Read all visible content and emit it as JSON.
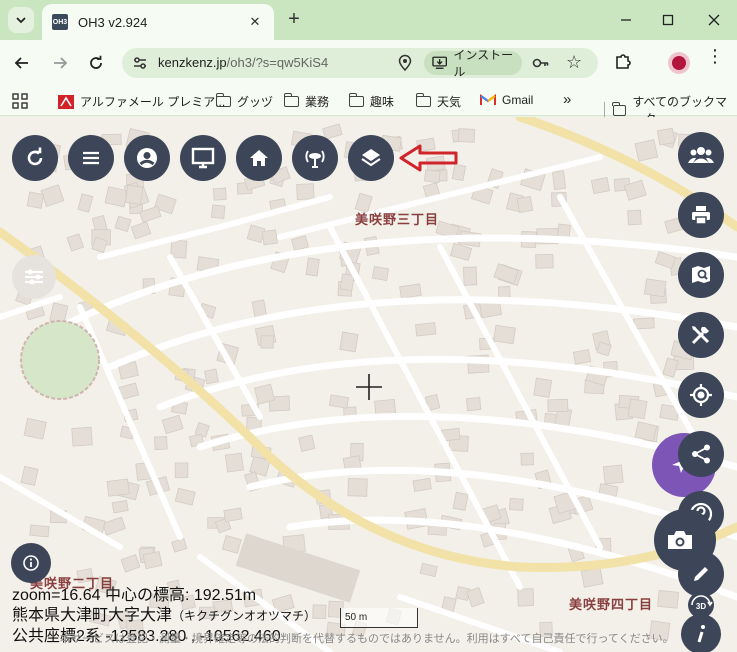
{
  "browser": {
    "tab_title": "OH3 v2.924",
    "tab_favicon": "OH3",
    "url_host": "kenzkenz.jp",
    "url_path": "/oh3/?s=qw5KiS4",
    "install_label": "インストール"
  },
  "bookmarks": [
    {
      "label": "アルファメール プレミア...",
      "icon": "alpha-mail-icon"
    },
    {
      "label": "グッヅ",
      "icon": "folder-icon"
    },
    {
      "label": "業務",
      "icon": "folder-icon"
    },
    {
      "label": "趣味",
      "icon": "folder-icon"
    },
    {
      "label": "天気",
      "icon": "folder-icon"
    },
    {
      "label": "Gmail",
      "icon": "gmail-icon"
    },
    {
      "label": "»",
      "icon": "more-icon"
    },
    {
      "label": "すべてのブックマーク",
      "icon": "folder-icon"
    }
  ],
  "map": {
    "town_labels": [
      "美咲野三丁目",
      "美咲野四丁目",
      "美咲野二丁目"
    ],
    "status": {
      "zoom_line": "zoom=16.64 中心の標高: 192.51m",
      "address": "熊本県大津町大字大津",
      "address_kana": "（キクチグンオオツマチ）",
      "coords": "公共座標2系 -12583.280 , -10562.460"
    },
    "scale_label": "50 m",
    "disclaimer": "本サービスは登記・測量・境界確定等の法的判断を代替するものではありません。利用はすべて自己責任で行ってください。",
    "annotation_color": "#d0232a",
    "button_color": "#3d4658"
  }
}
